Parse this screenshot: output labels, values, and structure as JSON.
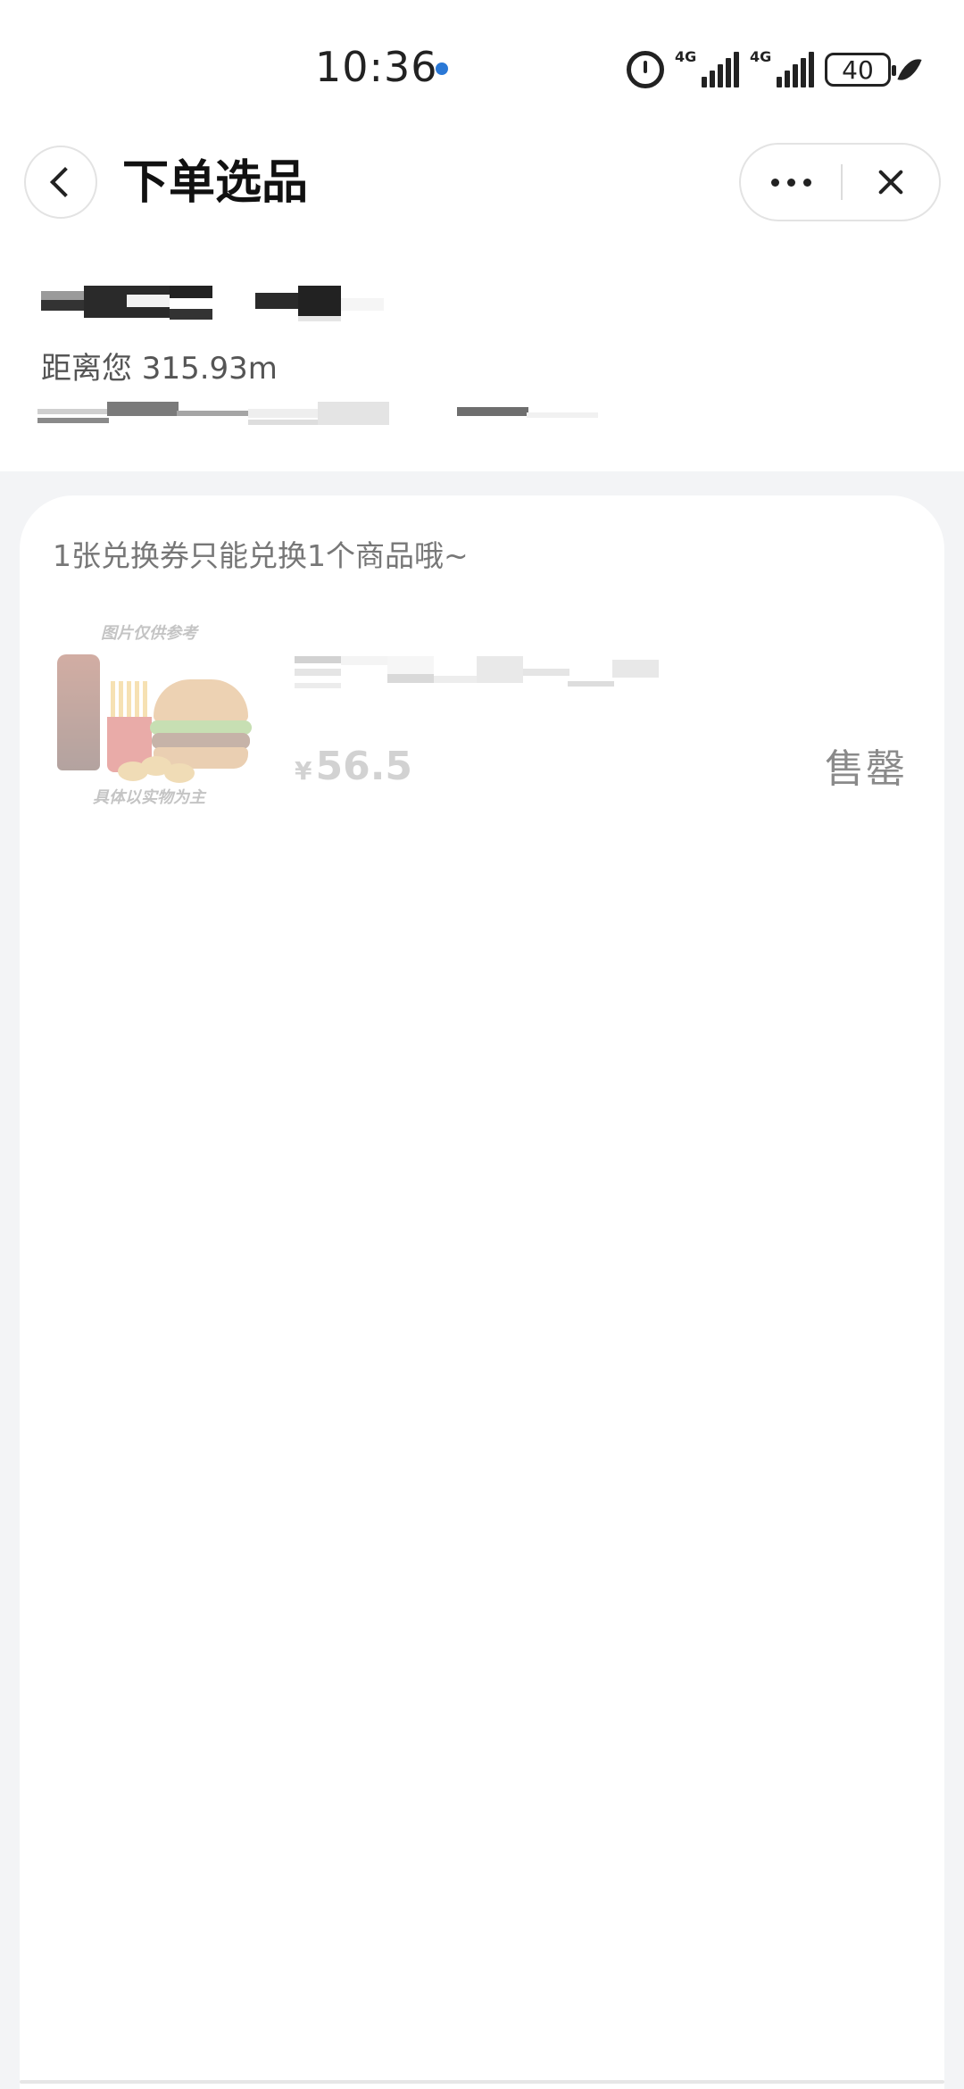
{
  "status_bar": {
    "time": "10:36",
    "signal1_label": "4G",
    "signal2_label": "4G",
    "battery": "40"
  },
  "header": {
    "title": "下单选品"
  },
  "store": {
    "distance": "距离您 315.93m"
  },
  "card": {
    "notice": "1张兑换券只能兑换1个商品哦~",
    "product": {
      "image_caption_top": "图片仅供参考",
      "image_caption_bottom": "具体以实物为主",
      "currency": "¥",
      "price": "56.5",
      "status": "售罄"
    }
  }
}
